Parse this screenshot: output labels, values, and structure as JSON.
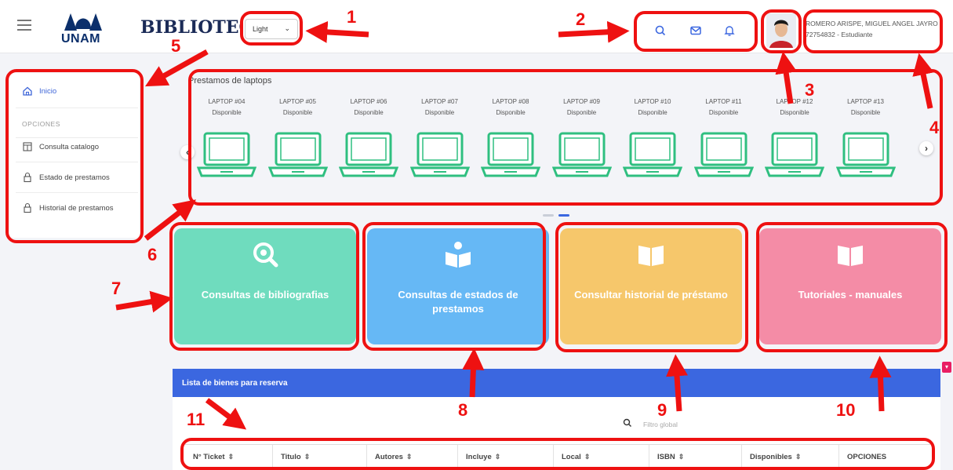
{
  "header": {
    "logo_text": "UNAM",
    "app_title": "BIBLIOTECA",
    "theme_select": {
      "value": "Light"
    },
    "user": {
      "name": "ROMERO ARISPE, MIGUEL ANGEL JAYRO",
      "subtitle": "72754832 - Estudiante"
    },
    "icons": [
      "search-icon",
      "mail-icon",
      "bell-icon"
    ]
  },
  "sidebar": {
    "home_label": "Inicio",
    "section_label": "OPCIONES",
    "items": [
      {
        "label": "Consulta catalogo",
        "icon": "catalog-icon"
      },
      {
        "label": "Estado de prestamos",
        "icon": "lock-icon"
      },
      {
        "label": "Historial de prestamos",
        "icon": "lock-icon"
      }
    ]
  },
  "carousel": {
    "title": "Prestamos de laptops",
    "laptops": [
      {
        "name": "LAPTOP #04",
        "status": "Disponible"
      },
      {
        "name": "LAPTOP #05",
        "status": "Disponible"
      },
      {
        "name": "LAPTOP #06",
        "status": "Disponible"
      },
      {
        "name": "LAPTOP #07",
        "status": "Disponible"
      },
      {
        "name": "LAPTOP #08",
        "status": "Disponible"
      },
      {
        "name": "LAPTOP #09",
        "status": "Disponible"
      },
      {
        "name": "LAPTOP #10",
        "status": "Disponible"
      },
      {
        "name": "LAPTOP #11",
        "status": "Disponible"
      },
      {
        "name": "LAPTOP #12",
        "status": "Disponible"
      },
      {
        "name": "LAPTOP #13",
        "status": "Disponible"
      }
    ],
    "prev_arrow": "‹",
    "next_arrow": "›"
  },
  "cards": [
    {
      "label": "Consultas de bibliografias",
      "color": "#6fdcbe",
      "icon": "search-icon"
    },
    {
      "label": "Consultas de estados de prestamos",
      "color": "#66b8f5",
      "icon": "reader-icon"
    },
    {
      "label": "Consultar historial de préstamo",
      "color": "#f6c76b",
      "icon": "book-icon"
    },
    {
      "label": "Tutoriales - manuales",
      "color": "#f48ca6",
      "icon": "book-icon"
    }
  ],
  "reserve_panel": {
    "title": "Lista de bienes para reserva",
    "filter_placeholder": "Filtro global",
    "columns": [
      "N° Ticket",
      "Titulo",
      "Autores",
      "Incluye",
      "Local",
      "ISBN",
      "Disponibles",
      "OPCIONES"
    ]
  },
  "annotations": [
    "1",
    "2",
    "3",
    "4",
    "5",
    "6",
    "7",
    "8",
    "9",
    "10",
    "11"
  ],
  "colors": {
    "accent": "#3b67e0",
    "laptop_green": "#2fbf80",
    "annotation_red": "#ee1111"
  }
}
